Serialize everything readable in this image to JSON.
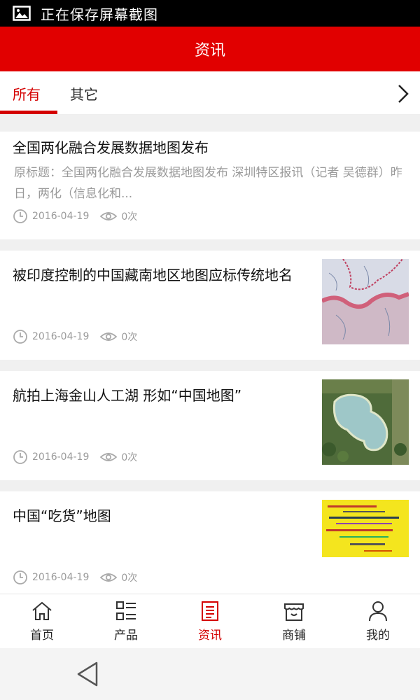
{
  "status_bar": {
    "text": "正在保存屏幕截图",
    "icon": "image-icon"
  },
  "header": {
    "title": "资讯"
  },
  "tabs": [
    {
      "label": "所有",
      "active": true
    },
    {
      "label": "其它",
      "active": false
    }
  ],
  "articles": [
    {
      "title": "全国两化融合发展数据地图发布",
      "summary": "原标题：全国两化融合发展数据地图发布 深圳特区报讯（记者 吴德群）昨日，两化（信息化和...",
      "date": "2016-04-19",
      "views": "0次"
    },
    {
      "title": "被印度控制的中国藏南地区地图应标传统地名",
      "date": "2016-04-19",
      "views": "0次",
      "thumbnail": "map-thumbnail"
    },
    {
      "title": "航拍上海金山人工湖 形如“中国地图”",
      "date": "2016-04-19",
      "views": "0次",
      "thumbnail": "lake-aerial-thumbnail"
    },
    {
      "title": "中国“吃货”地图",
      "date": "2016-04-19",
      "views": "0次",
      "thumbnail": "food-map-thumbnail"
    }
  ],
  "bottom_nav": [
    {
      "label": "首页",
      "icon": "home-icon",
      "active": false
    },
    {
      "label": "产品",
      "icon": "list-icon",
      "active": false
    },
    {
      "label": "资讯",
      "icon": "news-icon",
      "active": true
    },
    {
      "label": "商铺",
      "icon": "store-icon",
      "active": false
    },
    {
      "label": "我的",
      "icon": "user-icon",
      "active": false
    }
  ],
  "colors": {
    "brand_red": "#e10000",
    "active_red": "#d40000",
    "meta_gray": "#9a9a9a"
  }
}
